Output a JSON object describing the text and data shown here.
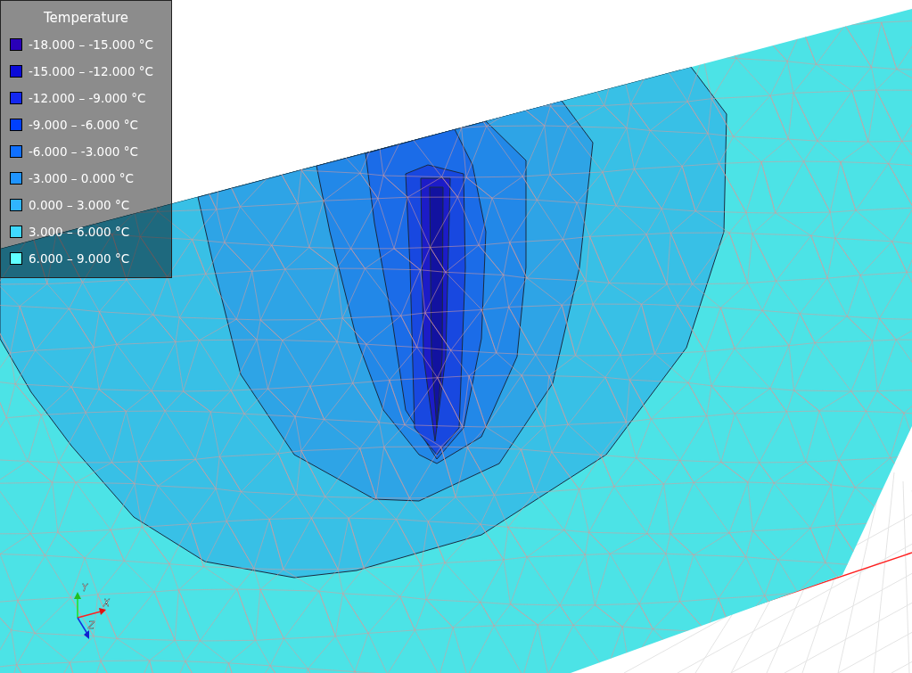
{
  "legend": {
    "title": "Temperature",
    "items": [
      {
        "label": "-18.000 – -15.000 °C",
        "color": "#2a00b8"
      },
      {
        "label": "-15.000 – -12.000 °C",
        "color": "#0a0ad8"
      },
      {
        "label": "-12.000 – -9.000 °C",
        "color": "#1428f0"
      },
      {
        "label": "-9.000 – -6.000 °C",
        "color": "#0040ff"
      },
      {
        "label": "-6.000 – -3.000 °C",
        "color": "#1070ff"
      },
      {
        "label": "-3.000 – 0.000 °C",
        "color": "#2094ff"
      },
      {
        "label": "0.000 – 3.000 °C",
        "color": "#30b4ff"
      },
      {
        "label": "3.000 – 6.000 °C",
        "color": "#40d8ff"
      },
      {
        "label": "6.000 – 9.000 °C",
        "color": "#60ffff"
      }
    ]
  },
  "axes": {
    "y_label": "Y",
    "x_label": "X",
    "z_label": "Z"
  }
}
